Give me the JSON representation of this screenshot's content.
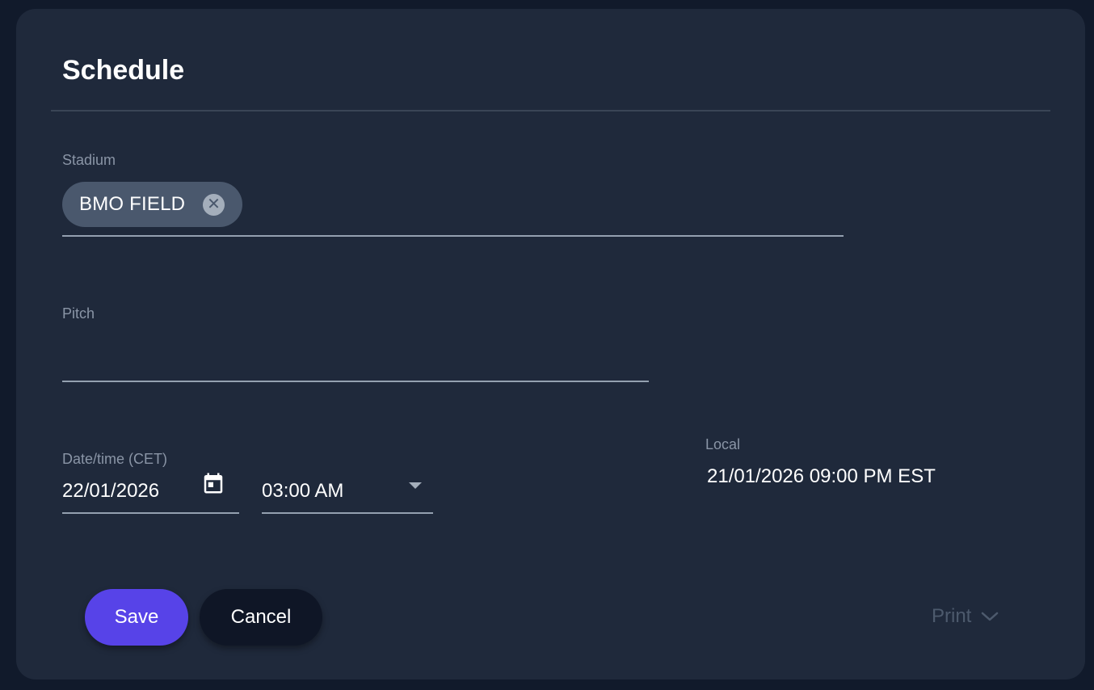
{
  "dialog": {
    "title": "Schedule"
  },
  "stadium": {
    "label": "Stadium",
    "chip": "BMO FIELD"
  },
  "pitch": {
    "label": "Pitch",
    "value": ""
  },
  "datetime": {
    "label": "Date/time (CET)",
    "date": "22/01/2026",
    "time": "03:00 AM"
  },
  "local": {
    "label": "Local",
    "value": "21/01/2026 09:00 PM EST"
  },
  "actions": {
    "save_label": "Save",
    "cancel_label": "Cancel",
    "print_label": "Print"
  },
  "colors": {
    "background": "#111a2b",
    "card": "#1f293b",
    "accent": "#5743e8",
    "chip": "#4a586d",
    "muted_text": "#8a95a6"
  },
  "icons": {
    "chip_remove": "close-circle-icon",
    "date": "calendar-icon",
    "time": "caret-down-icon",
    "print": "chevron-down-icon"
  }
}
